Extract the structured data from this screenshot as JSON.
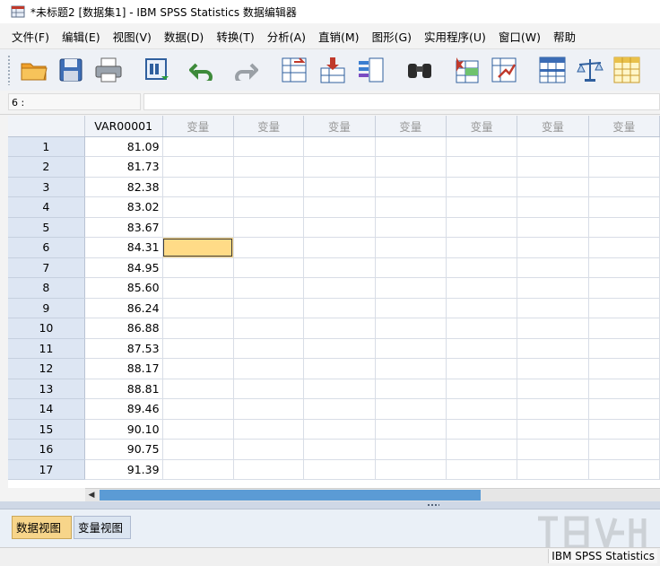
{
  "window": {
    "title": "*未标题2 [数据集1] - IBM SPSS Statistics 数据编辑器"
  },
  "menu": [
    "文件(F)",
    "编辑(E)",
    "视图(V)",
    "数据(D)",
    "转换(T)",
    "分析(A)",
    "直销(M)",
    "图形(G)",
    "实用程序(U)",
    "窗口(W)",
    "帮助"
  ],
  "toolbar": {
    "icons": [
      "open-folder-icon",
      "save-icon",
      "print-icon",
      "dialog-recall-icon",
      "undo-icon",
      "redo-icon",
      "go-to-case-icon",
      "go-to-variable-icon",
      "variables-icon",
      "find-icon",
      "insert-cases-icon",
      "insert-variable-icon",
      "split-file-icon",
      "weight-cases-icon",
      "select-cases-icon"
    ]
  },
  "cell_editor": {
    "ref": "6 :",
    "value": ""
  },
  "grid": {
    "columns": [
      "VAR00001",
      "变量",
      "变量",
      "变量",
      "变量",
      "变量",
      "变量",
      "变量"
    ],
    "rows": [
      {
        "n": "1",
        "v": "81.09"
      },
      {
        "n": "2",
        "v": "81.73"
      },
      {
        "n": "3",
        "v": "82.38"
      },
      {
        "n": "4",
        "v": "83.02"
      },
      {
        "n": "5",
        "v": "83.67"
      },
      {
        "n": "6",
        "v": "84.31"
      },
      {
        "n": "7",
        "v": "84.95"
      },
      {
        "n": "8",
        "v": "85.60"
      },
      {
        "n": "9",
        "v": "86.24"
      },
      {
        "n": "10",
        "v": "86.88"
      },
      {
        "n": "11",
        "v": "87.53"
      },
      {
        "n": "12",
        "v": "88.17"
      },
      {
        "n": "13",
        "v": "88.81"
      },
      {
        "n": "14",
        "v": "89.46"
      },
      {
        "n": "15",
        "v": "90.10"
      },
      {
        "n": "16",
        "v": "90.75"
      },
      {
        "n": "17",
        "v": "91.39"
      }
    ]
  },
  "tabs": {
    "data_view": "数据视图",
    "variable_view": "变量视图"
  },
  "status": {
    "text": "IBM SPSS Statistics"
  },
  "colors": {
    "selected_cell": "#ffdb87",
    "scroll_thumb": "#5b9bd5",
    "active_tab": "#f7d58a"
  }
}
